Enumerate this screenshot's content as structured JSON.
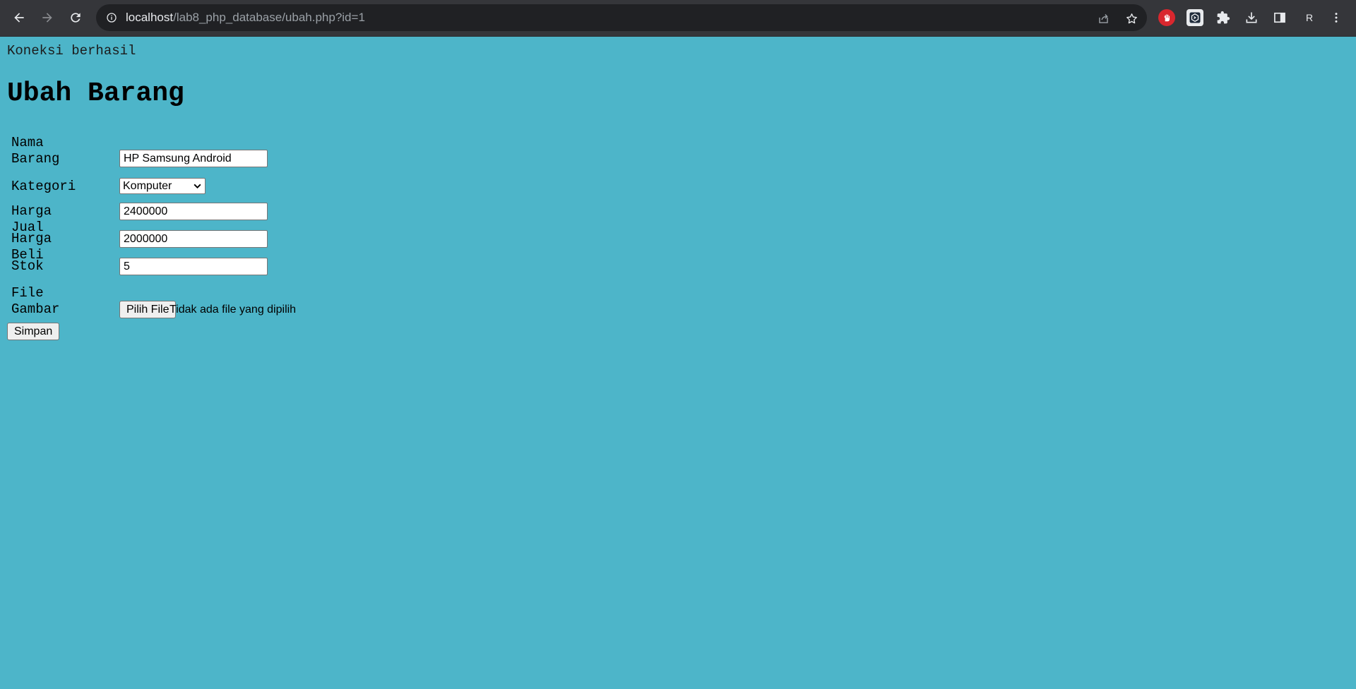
{
  "browser": {
    "url_host": "localhost",
    "url_path": "/lab8_php_database/ubah.php?id=1",
    "profile_initial": "R"
  },
  "page": {
    "status_text": "Koneksi berhasil",
    "title": "Ubah Barang"
  },
  "form": {
    "nama_label_line1": "Nama",
    "nama_label_line2": "Barang",
    "nama_value": "HP Samsung Android",
    "kategori_label": "Kategori",
    "kategori_selected": "Komputer",
    "harga_jual_label": "Harga Jual",
    "harga_jual_value": "2400000",
    "harga_beli_label": "Harga Beli",
    "harga_beli_value": "2000000",
    "stok_label": "Stok",
    "stok_value": "5",
    "file_label_line1": "File",
    "file_label_line2": "Gambar",
    "file_button": "Pilih File",
    "file_status": "Tidak ada file yang dipilih",
    "submit_label": "Simpan"
  },
  "colors": {
    "page_background": "#4db5c9",
    "toolbar_background": "#35363a",
    "omnibox_background": "#202124"
  }
}
